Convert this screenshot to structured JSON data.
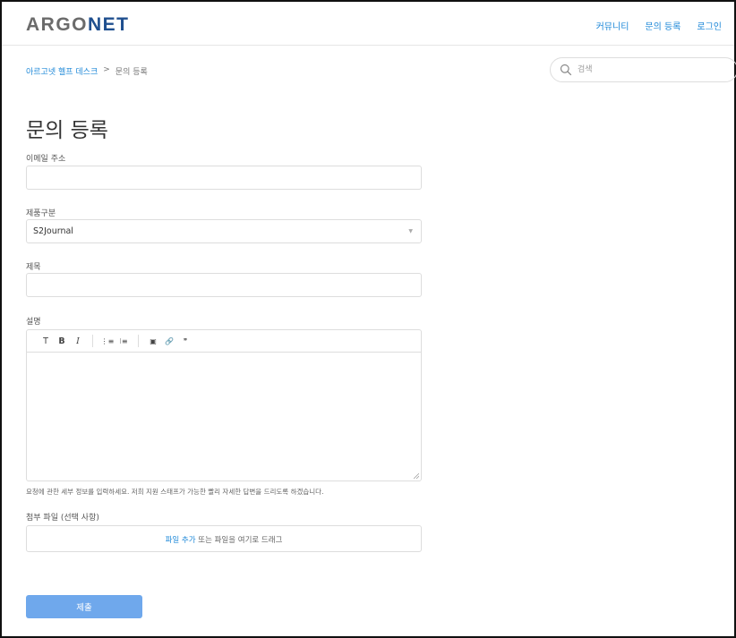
{
  "brand": {
    "logo_prefix": "ARGO",
    "logo_suffix": "NET",
    "accent": "#1f4f8f",
    "link_color": "#1e88d8"
  },
  "nav": {
    "items": [
      "커뮤니티",
      "문의 등록",
      "로그인"
    ]
  },
  "breadcrumb": {
    "home": "아르고넷 헬프 데스크",
    "separator": ">",
    "current": "문의 등록"
  },
  "search": {
    "placeholder": "검색"
  },
  "form": {
    "title": "문의 등록",
    "email_label": "이메일 주소",
    "email_value": "",
    "product_label": "제품구분",
    "product_value": "S2Journal",
    "subject_label": "제목",
    "subject_value": "",
    "description_label": "설명",
    "toolbar": {
      "heading": "T",
      "bold": "B",
      "italic": "I",
      "bullet_list": "⋮≡",
      "numbered_list": "⁝≡",
      "image": "▣",
      "link": "🔗",
      "quote": "❞"
    },
    "description_hint": "요청에 관한 세부 정보를 입력하세요. 저희 지원 스태프가 가능한 빨리 자세한 답변을 드리도록 하겠습니다.",
    "attachment_label": "첨부 파일 (선택 사항)",
    "attachment_link": "파일 추가",
    "attachment_text": " 또는 파일을 여기로 드래그",
    "submit_label": "제출",
    "submit_color": "#6fa8ec"
  }
}
